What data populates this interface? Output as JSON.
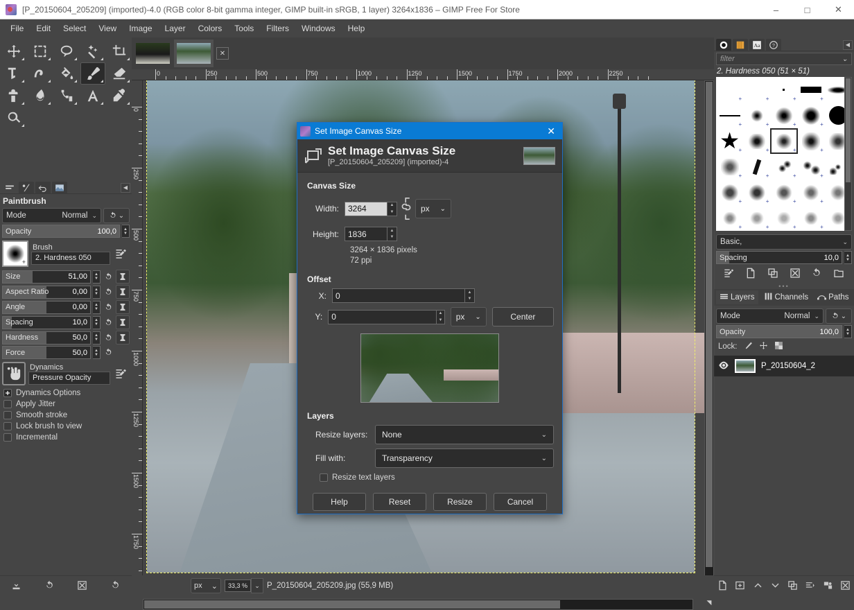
{
  "window": {
    "title": "[P_20150604_205209] (imported)-4.0 (RGB color 8-bit gamma integer, GIMP built-in sRGB, 1 layer) 3264x1836 – GIMP Free For Store",
    "minimize": "–",
    "maximize": "□",
    "close": "✕"
  },
  "menubar": {
    "items": [
      {
        "label": "File"
      },
      {
        "label": "Edit"
      },
      {
        "label": "Select"
      },
      {
        "label": "View"
      },
      {
        "label": "Image"
      },
      {
        "label": "Layer"
      },
      {
        "label": "Colors"
      },
      {
        "label": "Tools"
      },
      {
        "label": "Filters"
      },
      {
        "label": "Windows"
      },
      {
        "label": "Help"
      }
    ]
  },
  "toolbox": {
    "tools": [
      {
        "name": "move-tool"
      },
      {
        "name": "rectangle-select-tool"
      },
      {
        "name": "free-select-tool"
      },
      {
        "name": "fuzzy-select-tool"
      },
      {
        "name": "crop-tool"
      },
      {
        "name": "unified-transform-tool"
      },
      {
        "name": "warp-transform-tool"
      },
      {
        "name": "bucket-fill-tool"
      },
      {
        "name": "paintbrush-tool"
      },
      {
        "name": "eraser-tool"
      },
      {
        "name": "clone-tool"
      },
      {
        "name": "smudge-tool"
      },
      {
        "name": "paths-tool"
      },
      {
        "name": "text-tool"
      },
      {
        "name": "color-picker-tool"
      },
      {
        "name": "zoom-tool"
      }
    ],
    "active_tool": "paintbrush-tool",
    "foreground_color": "#000000",
    "background_color": "#ffffff"
  },
  "tool_options": {
    "title": "Paintbrush",
    "mode": {
      "label": "Mode",
      "value": "Normal"
    },
    "opacity": {
      "label": "Opacity",
      "value": "100,0",
      "fill_percent": 100
    },
    "brush": {
      "caption": "Brush",
      "value": "2. Hardness 050"
    },
    "sliders": [
      {
        "label": "Size",
        "value": "51,00",
        "fill_percent": 34,
        "has_pin": true
      },
      {
        "label": "Aspect Ratio",
        "value": "0,00",
        "fill_percent": 50,
        "has_pin": true
      },
      {
        "label": "Angle",
        "value": "0,00",
        "fill_percent": 50,
        "has_pin": true
      },
      {
        "label": "Spacing",
        "value": "10,0",
        "fill_percent": 10,
        "has_pin": true
      },
      {
        "label": "Hardness",
        "value": "50,0",
        "fill_percent": 50,
        "has_pin": true
      },
      {
        "label": "Force",
        "value": "50,0",
        "fill_percent": 50,
        "has_pin": false
      }
    ],
    "dynamics": {
      "caption": "Dynamics",
      "value": "Pressure Opacity"
    },
    "checks": [
      {
        "label": "Dynamics Options",
        "checked": true
      },
      {
        "label": "Apply Jitter",
        "checked": false
      },
      {
        "label": "Smooth stroke",
        "checked": false
      },
      {
        "label": "Lock brush to view",
        "checked": false
      },
      {
        "label": "Incremental",
        "checked": false
      }
    ]
  },
  "image_window": {
    "tabs": [
      {
        "name": "image-tab-1",
        "selected": false
      },
      {
        "name": "image-tab-2",
        "selected": true
      }
    ],
    "close_tab": "✕",
    "h_ruler_ticks": [
      "0",
      "250",
      "500",
      "750",
      "1000",
      "1250",
      "1500",
      "1750",
      "2000",
      "2250"
    ],
    "v_ruler_ticks": [
      "0",
      "250",
      "500",
      "750",
      "1000",
      "1250",
      "1500",
      "1750"
    ]
  },
  "statusbar": {
    "unit": "px",
    "zoom": "33,3 %",
    "file_info": "P_20150604_205209.jpg (55,9 MB)"
  },
  "right_dock": {
    "tabs": [
      {
        "name": "brushes-tab",
        "selected": true
      },
      {
        "name": "patterns-tab",
        "selected": false
      },
      {
        "name": "fonts-tab",
        "selected": false
      },
      {
        "name": "document-history-tab",
        "selected": false
      }
    ],
    "filter_placeholder": "filter",
    "selected_brush": "2. Hardness 050 (51 × 51)",
    "brush_tag": "Basic,",
    "spacing": {
      "label": "Spacing",
      "value": "10,0"
    },
    "action_icons": [
      "edit-brush-icon",
      "new-brush-icon",
      "duplicate-brush-icon",
      "delete-brush-icon",
      "refresh-brushes-icon",
      "open-brush-as-image-icon"
    ],
    "layer_tabs": [
      {
        "label": "Layers",
        "icon": "layers-icon",
        "selected": true
      },
      {
        "label": "Channels",
        "icon": "channels-icon",
        "selected": false
      },
      {
        "label": "Paths",
        "icon": "paths-icon",
        "selected": false
      }
    ],
    "mode": {
      "label": "Mode",
      "value": "Normal"
    },
    "opacity": {
      "label": "Opacity",
      "value": "100,0"
    },
    "lock": {
      "label": "Lock:",
      "icons": [
        "lock-pixels-icon",
        "lock-position-icon",
        "lock-alpha-icon"
      ]
    },
    "layers": [
      {
        "name": "P_20150604_2",
        "visible": true
      }
    ],
    "bottom_icons": [
      "new-layer-icon",
      "new-layer-group-icon",
      "raise-layer-icon",
      "lower-layer-icon",
      "duplicate-layer-icon",
      "anchor-layer-icon",
      "merge-down-icon",
      "delete-layer-icon"
    ]
  },
  "left_bottom_icons": [
    "save-tool-options-icon",
    "restore-tool-options-icon",
    "delete-tool-options-icon",
    "reset-tool-options-icon"
  ],
  "dialog": {
    "titlebar": "Set Image Canvas Size",
    "close": "✕",
    "heading": "Set Image Canvas Size",
    "subheading": "[P_20150604_205209] (imported)-4",
    "canvas_size": {
      "section": "Canvas Size",
      "width_label": "Width:",
      "width_value": "3264",
      "height_label": "Height:",
      "height_value": "1836",
      "unit": "px",
      "pixels_info": "3264 × 1836 pixels",
      "ppi_info": "72 ppi"
    },
    "offset": {
      "section": "Offset",
      "x_label": "X:",
      "x_value": "0",
      "y_label": "Y:",
      "y_value": "0",
      "unit": "px",
      "center_label": "Center"
    },
    "layers": {
      "section": "Layers",
      "resize_layers_label": "Resize layers:",
      "resize_layers_value": "None",
      "fill_with_label": "Fill with:",
      "fill_with_value": "Transparency",
      "resize_text_layers_label": "Resize text layers",
      "resize_text_layers_checked": false
    },
    "buttons": [
      {
        "label": "Help",
        "name": "help-button"
      },
      {
        "label": "Reset",
        "name": "reset-button"
      },
      {
        "label": "Resize",
        "name": "resize-button"
      },
      {
        "label": "Cancel",
        "name": "cancel-button"
      }
    ]
  },
  "colors": {
    "accent_blue": "#0a7bd4",
    "panel_bg": "#454545",
    "field_bg": "#2c2c2c",
    "canvas_guide": "#f2f26a"
  }
}
